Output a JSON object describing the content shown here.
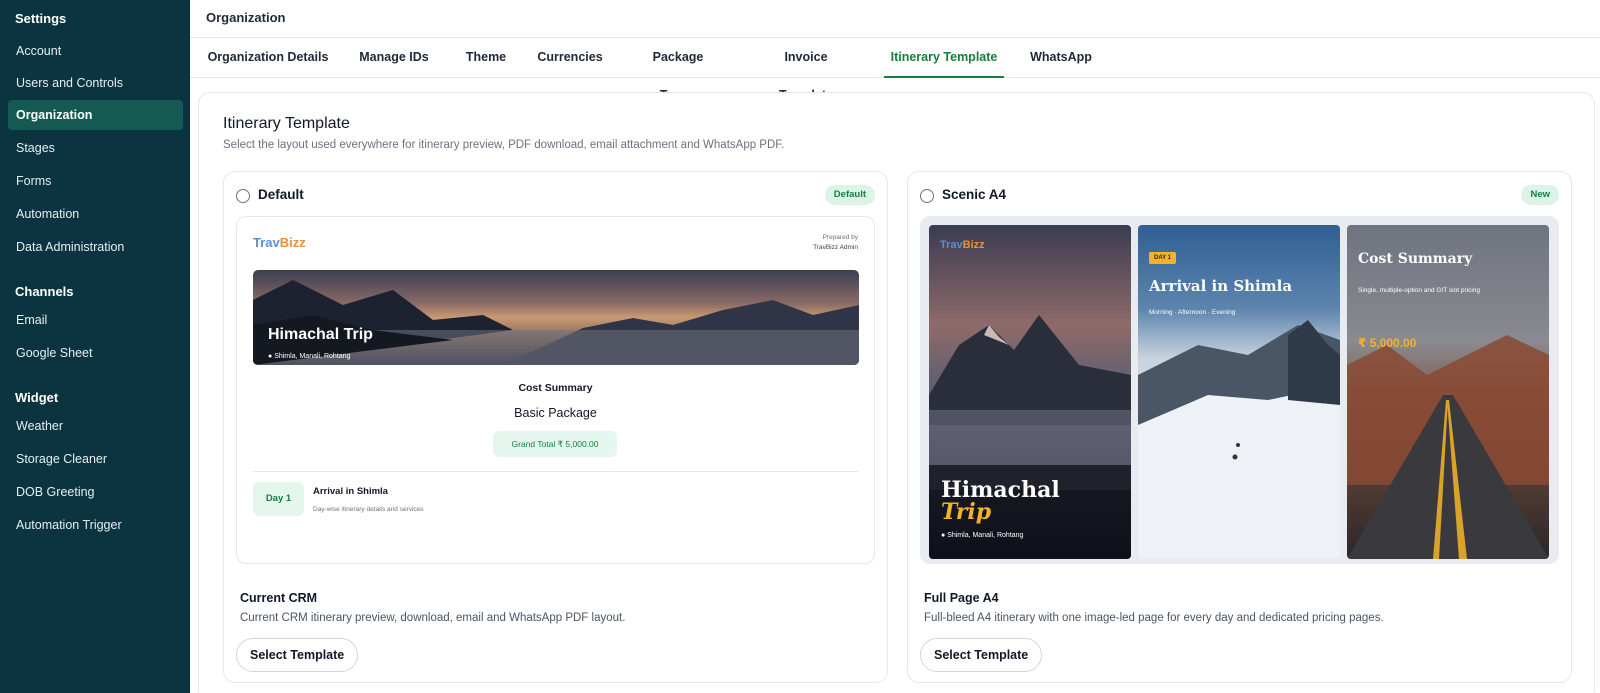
{
  "sidebar": {
    "heading": "Settings",
    "items": [
      {
        "label": "Account"
      },
      {
        "label": "Users and Controls"
      },
      {
        "label": "Organization"
      },
      {
        "label": "Stages"
      },
      {
        "label": "Forms"
      },
      {
        "label": "Automation"
      },
      {
        "label": "Data Administration"
      }
    ],
    "channels_heading": "Channels",
    "channels": [
      {
        "label": "Email"
      },
      {
        "label": "Google Sheet"
      }
    ],
    "widget_heading": "Widget",
    "widgets": [
      {
        "label": "Weather"
      },
      {
        "label": "Storage Cleaner"
      },
      {
        "label": "DOB Greeting"
      },
      {
        "label": "Automation Trigger"
      }
    ],
    "active_item": "Organization"
  },
  "header": {
    "title": "Organization"
  },
  "tabs": [
    {
      "label": "Organization Details"
    },
    {
      "label": "Manage IDs"
    },
    {
      "label": "Theme"
    },
    {
      "label": "Currencies"
    },
    {
      "label": "Package Terms"
    },
    {
      "label": "Invoice Template"
    },
    {
      "label": "Itinerary Template"
    },
    {
      "label": "WhatsApp"
    }
  ],
  "active_tab": "Itinerary Template",
  "main": {
    "title": "Itinerary Template",
    "subtitle": "Select the layout used everywhere for itinerary preview, PDF download, email attachment and WhatsApp PDF.",
    "cards": [
      {
        "name": "Default",
        "badge": "Default",
        "subtitle": "Current CRM",
        "description": "Current CRM itinerary preview, download, email and WhatsApp PDF layout.",
        "button": "Select Template",
        "preview": {
          "logo_part1": "Trav",
          "logo_part2": "Bizz",
          "prepared_by": "Prepared by",
          "prepared_name": "TravBizz Admin",
          "hero_title": "Himachal Trip",
          "hero_location": "Shimla, Manali, Rohtang",
          "cost_label": "Cost Summary",
          "package_name": "Basic Package",
          "grand_total": "Grand Total  ₹ 5,000.00",
          "day_badge": "Day 1",
          "day_title": "Arrival in Shimla",
          "day_desc": "Day-wise itinerary details and services"
        }
      },
      {
        "name": "Scenic A4",
        "badge": "New",
        "subtitle": "Full Page A4",
        "description": "Full-bleed A4 itinerary with one image-led page for every day and dedicated pricing pages.",
        "button": "Select Template",
        "preview": {
          "logo_part1": "Trav",
          "logo_part2": "Bizz",
          "page1_title_line1": "Himachal",
          "page1_title_line2": "Trip",
          "page1_location": "Shimla, Manali, Rohtang",
          "page2_badge": "DAY 1",
          "page2_title": "Arrival in Shimla",
          "page2_sub": "Morning · Afternoon · Evening",
          "page3_title": "Cost Summary",
          "page3_sub": "Single, multiple-option and GIT slot pricing",
          "page3_price": "₹ 5,000.00"
        }
      }
    ]
  },
  "colors": {
    "sidebar_bg": "#0b3440",
    "sidebar_active": "#145a52",
    "accent_green": "#15803d",
    "badge_bg": "#dcf3e8",
    "gold": "#f5b323"
  }
}
